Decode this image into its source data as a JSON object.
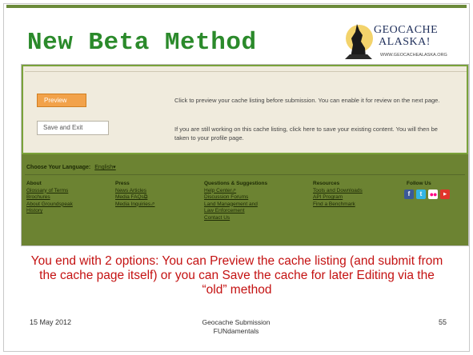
{
  "slide": {
    "title": "New Beta Method",
    "caption": "You end with 2 options: You can Preview the cache listing (and submit from the cache page itself) or you can Save the cache for later Editing via the “old” method",
    "footer_date": "15 May 2012",
    "footer_center": "Geocache Submission FUNdamentals",
    "page_number": "55",
    "logo_line1": "GEOCACHE",
    "logo_line2": "ALASKA!",
    "logo_url": "WWW.GEOCACHEALASKA.ORG"
  },
  "screenshot": {
    "preview_button": "Preview",
    "preview_desc": "Click to preview your cache listing before submission. You can enable it for review on the next page.",
    "save_button": "Save and Exit",
    "save_desc": "If you are still working on this cache listing, click here to save your existing content. You will then be taken to your profile page.",
    "language_label": "Choose Your Language:",
    "language_value": "English▾",
    "footer_columns": [
      {
        "heading": "About",
        "links": [
          "Glossary of Terms",
          "Brochures",
          "About Groundspeak",
          "History"
        ]
      },
      {
        "heading": "Press",
        "links": [
          "News Articles",
          "Media FAQs⧉",
          "Media Inquiries⬀"
        ]
      },
      {
        "heading": "Questions & Suggestions",
        "links": [
          "Help Center⬀",
          "Discussion Forums",
          "Land Management and",
          "Law Enforcement",
          "Contact Us"
        ]
      },
      {
        "heading": "Resources",
        "links": [
          "Tools and Downloads",
          "API Program",
          "Find a Benchmark"
        ]
      }
    ],
    "follow_us": "Follow Us",
    "social_icons": [
      "facebook-icon",
      "twitter-icon",
      "flickr-icon",
      "youtube-icon"
    ]
  },
  "colors": {
    "title_green": "#2b8a2b",
    "caption_red": "#c41212",
    "footer_olive": "#6c8332",
    "preview_orange": "#f2a24a"
  }
}
